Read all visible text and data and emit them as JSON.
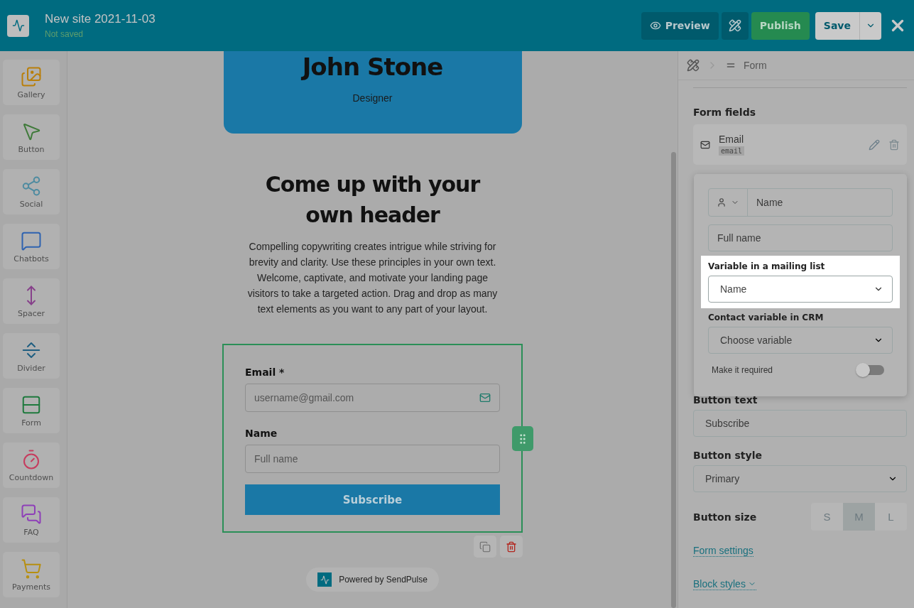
{
  "header": {
    "title": "New site 2021-11-03",
    "status": "Not saved",
    "preview": "Preview",
    "publish": "Publish",
    "save": "Save"
  },
  "sidebar": {
    "items": [
      {
        "kind": "gallery",
        "label": "Gallery"
      },
      {
        "kind": "button",
        "label": "Button"
      },
      {
        "kind": "social",
        "label": "Social"
      },
      {
        "kind": "chatbots",
        "label": "Chatbots"
      },
      {
        "kind": "spacer",
        "label": "Spacer"
      },
      {
        "kind": "divider",
        "label": "Divider"
      },
      {
        "kind": "form",
        "label": "Form"
      },
      {
        "kind": "countdown",
        "label": "Countdown"
      },
      {
        "kind": "faq",
        "label": "FAQ"
      },
      {
        "kind": "payments",
        "label": "Payments"
      }
    ]
  },
  "canvas": {
    "profile": {
      "name": "John Stone",
      "role": "Designer"
    },
    "heading": "Come up with your own header",
    "paragraph": "Compelling copywriting creates intrigue while striving for brevity and clarity. Use these principles in your own text. Welcome, captivate, and motivate your landing page visitors to take a targeted action. Drag and drop as many text elements as you want to any part of your layout.",
    "form": {
      "fields": [
        {
          "kind": "email",
          "label": "Email *",
          "placeholder": "username@gmail.com"
        },
        {
          "kind": "text",
          "label": "Name",
          "placeholder": "Full name"
        }
      ],
      "button": "Subscribe"
    },
    "footer": "Powered by SendPulse"
  },
  "panel": {
    "breadcrumb": "Form",
    "section": "Form fields",
    "fields": [
      {
        "name": "Email",
        "code": "email"
      }
    ],
    "editor": {
      "name": "Name",
      "label_value": "Full name",
      "mailing_label": "Variable in a mailing list",
      "mailing_value": "Name",
      "crm_label": "Contact variable in CRM",
      "crm_value": "Choose variable",
      "required_label": "Make it required",
      "required": false
    },
    "button_text_label": "Button text",
    "button_text": "Subscribe",
    "button_style_label": "Button style",
    "button_style": "Primary",
    "button_size_label": "Button size",
    "sizes": [
      {
        "label": "S",
        "selected": false
      },
      {
        "label": "M",
        "selected": true
      },
      {
        "label": "L",
        "selected": false
      }
    ],
    "links": [
      "Form settings",
      "Block styles"
    ]
  }
}
